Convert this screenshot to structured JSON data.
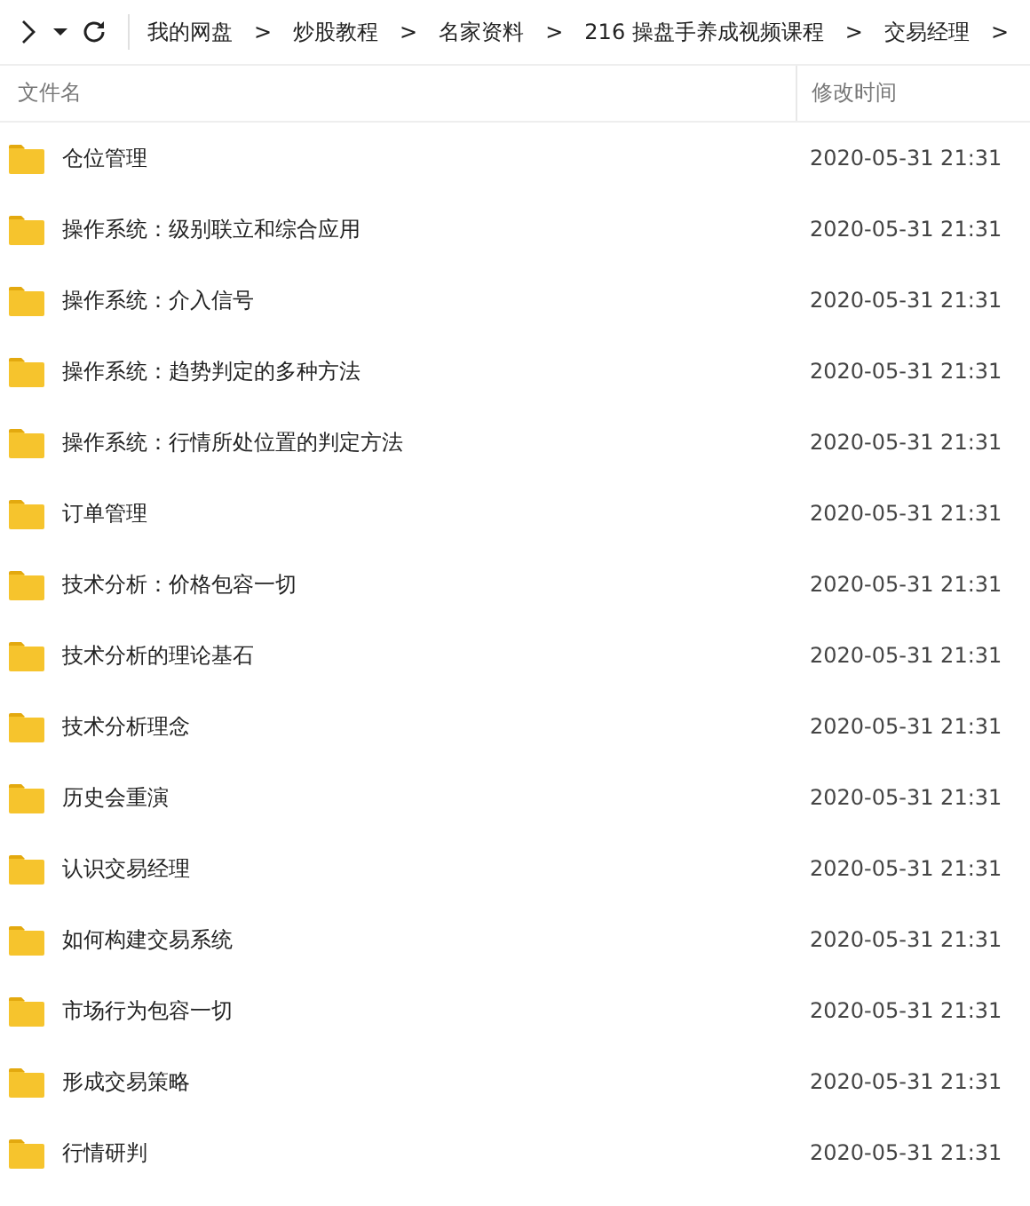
{
  "breadcrumb": [
    {
      "label": "我的网盘"
    },
    {
      "label": "炒股教程"
    },
    {
      "label": "名家资料"
    },
    {
      "label": "216 操盘手养成视频课程"
    },
    {
      "label": "交易经理"
    }
  ],
  "separator": ">",
  "table": {
    "columns": [
      "文件名",
      "修改时间"
    ],
    "rows": [
      {
        "name": "仓位管理",
        "modified": "2020-05-31 21:31"
      },
      {
        "name": "操作系统：级别联立和综合应用",
        "modified": "2020-05-31 21:31"
      },
      {
        "name": "操作系统：介入信号",
        "modified": "2020-05-31 21:31"
      },
      {
        "name": "操作系统：趋势判定的多种方法",
        "modified": "2020-05-31 21:31"
      },
      {
        "name": "操作系统：行情所处位置的判定方法",
        "modified": "2020-05-31 21:31"
      },
      {
        "name": "订单管理",
        "modified": "2020-05-31 21:31"
      },
      {
        "name": "技术分析：价格包容一切",
        "modified": "2020-05-31 21:31"
      },
      {
        "name": "技术分析的理论基石",
        "modified": "2020-05-31 21:31"
      },
      {
        "name": "技术分析理念",
        "modified": "2020-05-31 21:31"
      },
      {
        "name": "历史会重演",
        "modified": "2020-05-31 21:31"
      },
      {
        "name": "认识交易经理",
        "modified": "2020-05-31 21:31"
      },
      {
        "name": "如何构建交易系统",
        "modified": "2020-05-31 21:31"
      },
      {
        "name": "市场行为包容一切",
        "modified": "2020-05-31 21:31"
      },
      {
        "name": "形成交易策略",
        "modified": "2020-05-31 21:31"
      },
      {
        "name": "行情研判",
        "modified": "2020-05-31 21:31"
      }
    ]
  }
}
